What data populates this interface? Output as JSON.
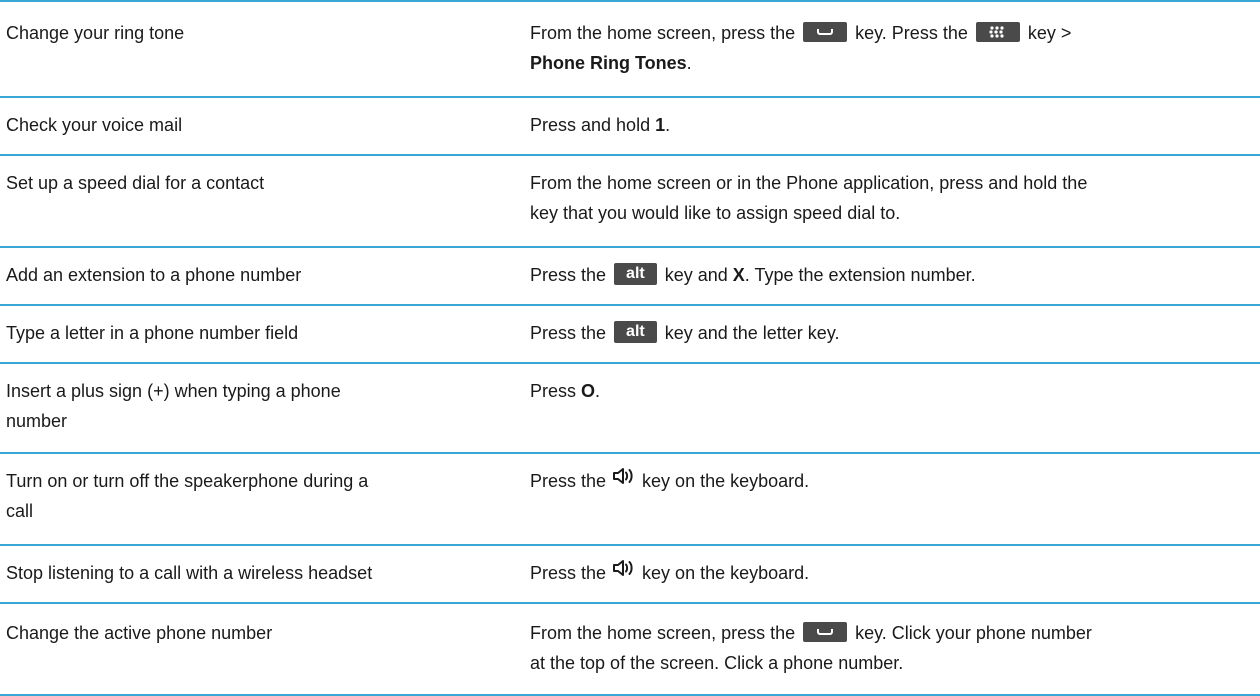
{
  "rows": [
    {
      "task": "Change your ring tone",
      "t1": "From the home screen, press the",
      "t2": "key. Press the",
      "t3": "key >",
      "b1": "Phone Ring Tones",
      "t4": "."
    },
    {
      "task": "Check your voice mail",
      "t1": "Press and hold ",
      "b1": "1",
      "t2": "."
    },
    {
      "task": "Set up a speed dial for a contact",
      "line1": "From the home screen or in the Phone application, press and hold the",
      "line2": "key that you would like to assign speed dial to."
    },
    {
      "task": "Add an extension to a phone number",
      "t1": "Press the",
      "key": "alt",
      "t2": "key and ",
      "b1": "X",
      "t3": ". Type the extension number."
    },
    {
      "task": "Type a letter in a phone number field",
      "t1": "Press the",
      "key": "alt",
      "t2": "key and the letter key."
    },
    {
      "task_line1": "Insert a plus sign (+) when typing a phone",
      "task_line2": "number",
      "t1": "Press ",
      "b1": "O",
      "t2": "."
    },
    {
      "task_line1": "Turn on or turn off the speakerphone during a",
      "task_line2": "call",
      "t1": "Press the",
      "t2": "key on the keyboard."
    },
    {
      "task": "Stop listening to a call with a wireless headset",
      "t1": "Press the",
      "t2": "key on the keyboard."
    },
    {
      "task": "Change the active phone number",
      "t1": "From the home screen, press the",
      "t2": "key. Click your phone number",
      "line2": "at the top of the screen. Click a phone number."
    }
  ],
  "icons": {
    "send_key": "send-key-icon",
    "menu_key": "menu-key-icon",
    "speaker_key": "speaker-key-icon"
  },
  "colors": {
    "rule": "#3aa6d6",
    "key_bg": "#4a4a4a"
  }
}
